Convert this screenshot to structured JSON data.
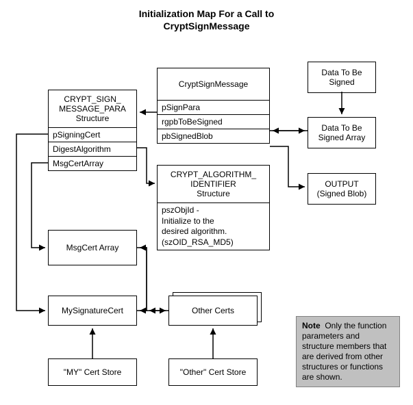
{
  "title": {
    "line1": "Initialization Map For a Call to",
    "line2": "CryptSignMessage"
  },
  "boxes": {
    "cryptSignMessage": {
      "header": "CryptSignMessage",
      "pSignPara": "pSignPara",
      "rgpbToBeSigned": "rgpbToBeSigned",
      "pbSignedBlob": "pbSignedBlob"
    },
    "messagePara": {
      "header1": "CRYPT_SIGN_",
      "header2": "MESSAGE_PARA",
      "header3": "Structure",
      "pSigningCert": "pSigningCert",
      "digestAlgorithm": "DigestAlgorithm",
      "msgCertArray": "MsgCertArray"
    },
    "algId": {
      "header1": "CRYPT_ALGORITHM_",
      "header2": "IDENTIFIER",
      "header3": "Structure",
      "body1": "pszObjId -",
      "body2": "Initialize to the",
      "body3": "desired algorithm.",
      "body4": "(szOID_RSA_MD5)"
    },
    "dataToBeSigned": {
      "line1": "Data To Be",
      "line2": "Signed"
    },
    "dataToBeSignedArray": {
      "line1": "Data To Be",
      "line2": "Signed Array"
    },
    "output": {
      "line1": "OUTPUT",
      "line2": "(Signed Blob)"
    },
    "msgCertArrayBox": "MsgCert Array",
    "mySignatureCert": "MySignatureCert",
    "otherCerts": "Other Certs",
    "myCertStore": "\"MY\" Cert Store",
    "otherCertStore": "\"Other\" Cert Store"
  },
  "note": {
    "label": "Note",
    "text": "Only the function parameters and structure members that are derived from other structures or functions are shown."
  }
}
